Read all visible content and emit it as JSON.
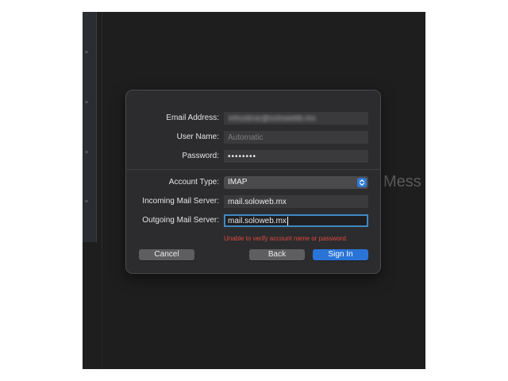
{
  "background": {
    "partial_text": "Mess"
  },
  "dialog": {
    "email": {
      "label": "Email Address:",
      "value": "mhusbrar@solowebb.mx"
    },
    "username": {
      "label": "User Name:",
      "placeholder": "Automatic"
    },
    "password": {
      "label": "Password:",
      "value": "••••••••"
    },
    "account_type": {
      "label": "Account Type:",
      "value": "IMAP"
    },
    "incoming": {
      "label": "Incoming Mail Server:",
      "value": "mail.soloweb.mx"
    },
    "outgoing": {
      "label": "Outgoing Mail Server:",
      "value": "mail.soloweb.mx"
    },
    "error": "Unable to verify account name or password.",
    "buttons": {
      "cancel": "Cancel",
      "back": "Back",
      "sign_in": "Sign In"
    }
  },
  "colors": {
    "accent": "#2a74d8",
    "error": "#e0483c",
    "focus_ring": "#3f89c4"
  }
}
